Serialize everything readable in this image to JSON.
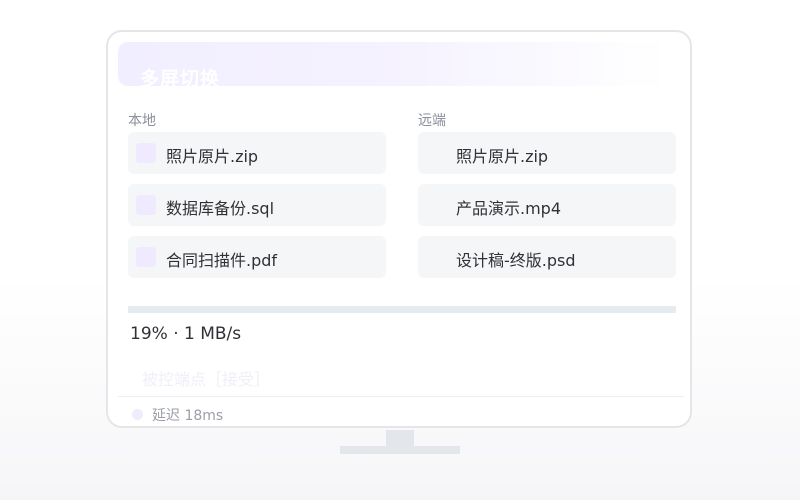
{
  "header": {
    "title": "多屏切换"
  },
  "local": {
    "label": "本地",
    "files": [
      {
        "name": "照片原片.zip"
      },
      {
        "name": "数据库备份.sql"
      },
      {
        "name": "合同扫描件.pdf"
      }
    ]
  },
  "remote": {
    "label": "远端",
    "files": [
      {
        "name": "照片原片.zip"
      },
      {
        "name": "产品演示.mp4"
      },
      {
        "name": "设计稿-终版.psd"
      }
    ]
  },
  "transfer": {
    "progress_percent": 19,
    "status_text": "19% · 1 MB/s"
  },
  "endpoint": {
    "text": "被控端点［接受］"
  },
  "footer": {
    "latency_text": "延迟 18ms"
  },
  "colors": {
    "accent_light": "#efeaff",
    "header_bg": "#f1eeff",
    "item_bg": "#f5f6f8",
    "progress_track": "#e6ebf0"
  }
}
